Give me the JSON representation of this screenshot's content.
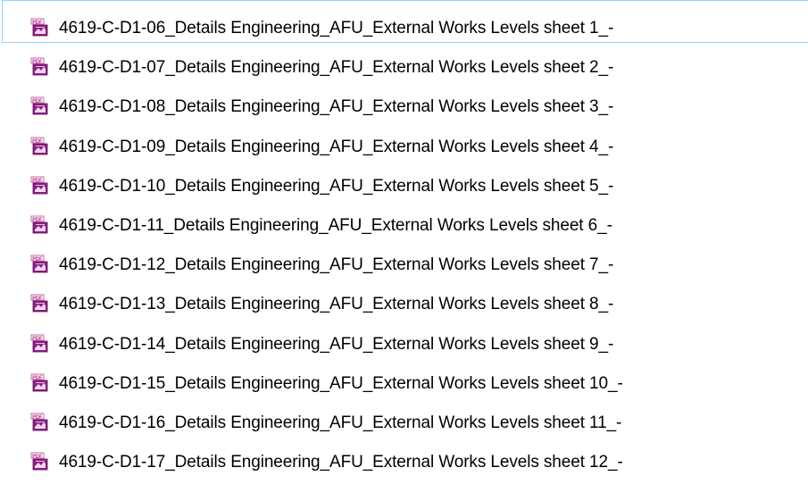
{
  "file_list": {
    "icon": "pdf-file-icon",
    "accent_color": "#9b1f8f",
    "focus_color": "#99d1ff",
    "items": [
      {
        "name": "4619-C-D1-06_Details Engineering_AFU_External Works Levels sheet 1_-"
      },
      {
        "name": "4619-C-D1-07_Details Engineering_AFU_External Works Levels sheet 2_-"
      },
      {
        "name": "4619-C-D1-08_Details Engineering_AFU_External Works Levels sheet 3_-"
      },
      {
        "name": "4619-C-D1-09_Details Engineering_AFU_External Works Levels sheet 4_-"
      },
      {
        "name": "4619-C-D1-10_Details Engineering_AFU_External Works Levels sheet 5_-"
      },
      {
        "name": "4619-C-D1-11_Details Engineering_AFU_External Works Levels sheet 6_-"
      },
      {
        "name": "4619-C-D1-12_Details Engineering_AFU_External Works Levels sheet 7_-"
      },
      {
        "name": "4619-C-D1-13_Details Engineering_AFU_External Works Levels sheet 8_-"
      },
      {
        "name": "4619-C-D1-14_Details Engineering_AFU_External Works Levels sheet 9_-"
      },
      {
        "name": "4619-C-D1-15_Details Engineering_AFU_External Works Levels sheet 10_-"
      },
      {
        "name": "4619-C-D1-16_Details Engineering_AFU_External Works Levels sheet 11_-"
      },
      {
        "name": "4619-C-D1-17_Details Engineering_AFU_External Works Levels sheet 12_-"
      }
    ]
  }
}
